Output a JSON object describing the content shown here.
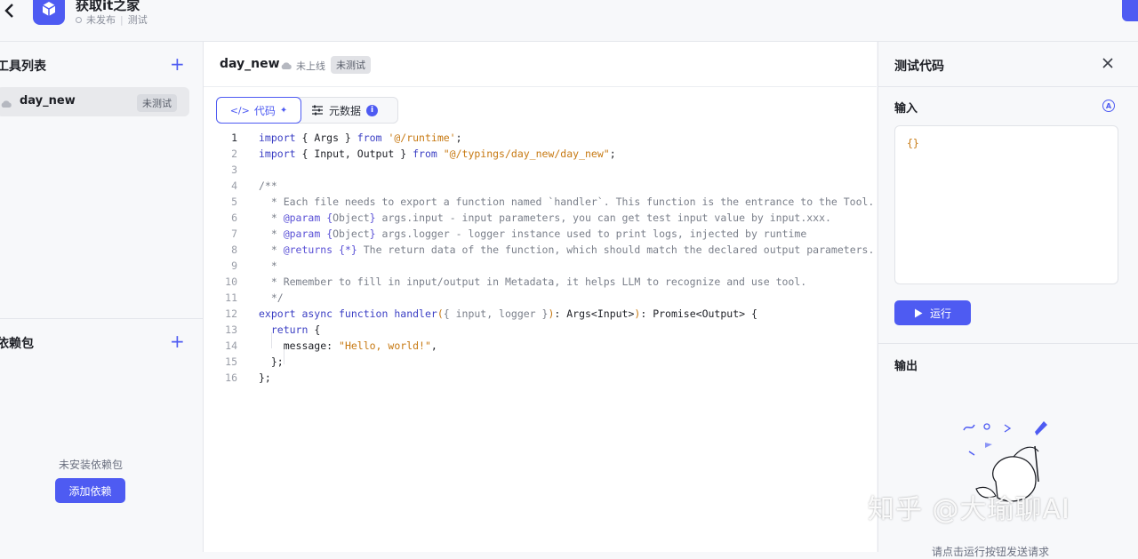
{
  "header": {
    "app_title": "获取it之家",
    "publish_status": "未发布",
    "mode": "测试"
  },
  "left": {
    "tools_title": "工具列表",
    "tool": {
      "name": "day_new",
      "tag": "未测试"
    },
    "deps_title": "依赖包",
    "deps_empty": "未安装依赖包",
    "add_dep": "添加依赖"
  },
  "center": {
    "title": "day_new",
    "online_status": "未上线",
    "test_tag": "未测试",
    "tab_code": "代码",
    "tab_meta": "元数据",
    "line_numbers": [
      "1",
      "2",
      "3",
      "4",
      "5",
      "6",
      "7",
      "8",
      "9",
      "10",
      "11",
      "12",
      "13",
      "14",
      "15",
      "16"
    ]
  },
  "right": {
    "title": "测试代码",
    "input_label": "输入",
    "input_value": "{}",
    "run_label": "运行",
    "output_label": "输出",
    "hint": "请点击运行按钮发送请求"
  },
  "watermark": "知乎 @大瑜聊AI",
  "colors": {
    "accent": "#4e5bf2",
    "string": "#c77912",
    "keyword": "#3b3fc4"
  },
  "icons": [
    "back-arrow-icon",
    "app-cube-icon",
    "plus-icon",
    "cloud-icon",
    "code-icon",
    "sparkle-icon",
    "sliders-icon",
    "info-icon",
    "close-icon",
    "ai-icon",
    "play-icon"
  ]
}
